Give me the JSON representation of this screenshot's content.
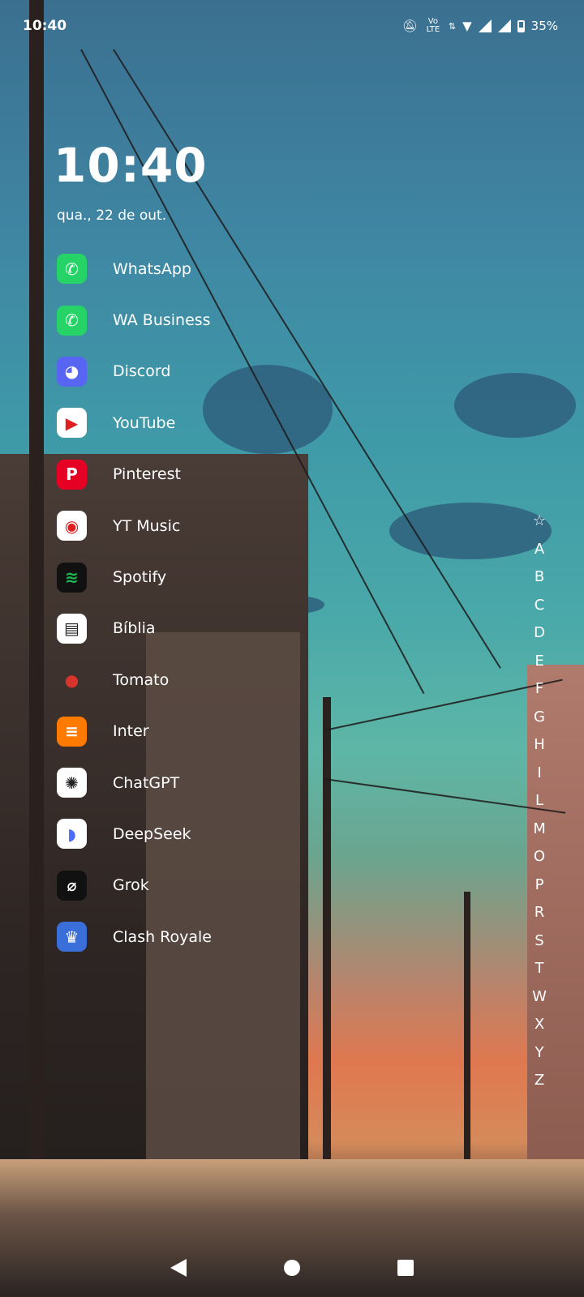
{
  "status_bar": {
    "time": "10:40",
    "volte": "Vo LTE",
    "battery": "35%",
    "icons": [
      "mute-bell-icon",
      "volte-icon",
      "data-arrows-icon",
      "wifi-icon",
      "signal-icon",
      "signal-icon",
      "battery-icon"
    ]
  },
  "clock": {
    "time": "10:40",
    "date": "qua., 22 de out."
  },
  "apps": [
    {
      "label": "WhatsApp",
      "icon": "whatsapp-icon",
      "color": "#25D366",
      "glyph": "✆"
    },
    {
      "label": "WA Business",
      "icon": "whatsapp-business-icon",
      "color": "#25D366",
      "glyph": "✆"
    },
    {
      "label": "Discord",
      "icon": "discord-icon",
      "color": "#5865F2",
      "glyph": "◕"
    },
    {
      "label": "YouTube",
      "icon": "youtube-icon",
      "color": "#ffffff",
      "glyph": "▶"
    },
    {
      "label": "Pinterest",
      "icon": "pinterest-icon",
      "color": "#E60023",
      "glyph": "P"
    },
    {
      "label": "YT Music",
      "icon": "yt-music-icon",
      "color": "#ffffff",
      "glyph": "◉"
    },
    {
      "label": "Spotify",
      "icon": "spotify-icon",
      "color": "#111111",
      "glyph": "≋"
    },
    {
      "label": "Bíblia",
      "icon": "bible-icon",
      "color": "#ffffff",
      "glyph": "▤"
    },
    {
      "label": "Tomato",
      "icon": "tomato-icon",
      "color": "transparent",
      "glyph": "●"
    },
    {
      "label": "Inter",
      "icon": "inter-icon",
      "color": "#FF7A00",
      "glyph": "≡"
    },
    {
      "label": "ChatGPT",
      "icon": "chatgpt-icon",
      "color": "#ffffff",
      "glyph": "✺"
    },
    {
      "label": "DeepSeek",
      "icon": "deepseek-icon",
      "color": "#ffffff",
      "glyph": "◗"
    },
    {
      "label": "Grok",
      "icon": "grok-icon",
      "color": "#111111",
      "glyph": "⌀"
    },
    {
      "label": "Clash Royale",
      "icon": "clash-royale-icon",
      "color": "#3a6ed8",
      "glyph": "♛"
    }
  ],
  "alphabet": [
    "☆",
    "A",
    "B",
    "C",
    "D",
    "E",
    "F",
    "G",
    "H",
    "I",
    "L",
    "M",
    "O",
    "P",
    "R",
    "S",
    "T",
    "W",
    "X",
    "Y",
    "Z"
  ]
}
